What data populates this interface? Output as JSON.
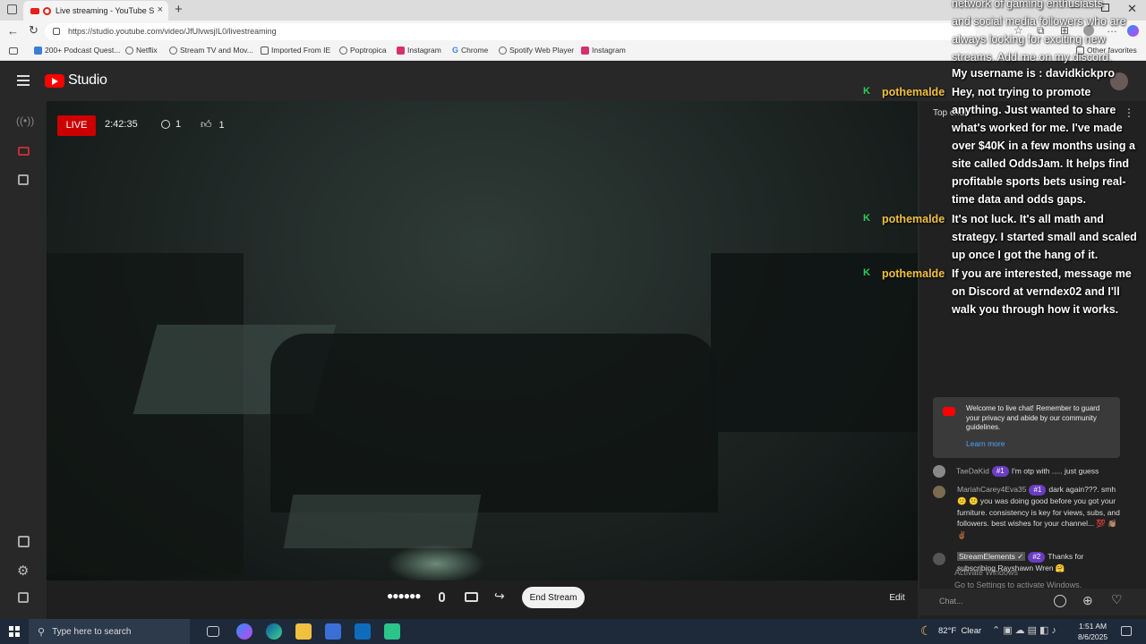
{
  "browser": {
    "tab_title": "Live streaming - YouTube St",
    "url": "https://studio.youtube.com/video/JfUlvwsjIL0/livestreaming",
    "favorites": [
      {
        "label": "200+ Podcast Quest...",
        "icon": "podcast-icon",
        "color": "#3b7dd8"
      },
      {
        "label": "Netflix",
        "icon": "globe-icon",
        "color": "#666666"
      },
      {
        "label": "Stream TV and Mov...",
        "icon": "globe-icon",
        "color": "#666666"
      },
      {
        "label": "Imported From IE",
        "icon": "folder-icon",
        "color": "#555555"
      },
      {
        "label": "Poptropica",
        "icon": "globe-icon",
        "color": "#666666"
      },
      {
        "label": "Instagram",
        "icon": "instagram-icon",
        "color": "#d6306e"
      },
      {
        "label": "Chrome",
        "icon": "google-icon",
        "color": "#4285f4"
      },
      {
        "label": "Spotify Web Player",
        "icon": "globe-icon",
        "color": "#666666"
      },
      {
        "label": "Instagram",
        "icon": "instagram-icon",
        "color": "#d6306e"
      }
    ],
    "other_favorites": "Other favorites"
  },
  "studio": {
    "brand": "Studio",
    "live_badge": "LIVE",
    "elapsed": "2:42:35",
    "viewers": "1",
    "likes": "1",
    "end_stream": "End Stream",
    "edit": "Edit",
    "top_chat": "Top chat"
  },
  "overlay": {
    "intro_lines": [
      "network of gaming enthusiasts",
      "and social media followers who are",
      "always looking for exciting new",
      "streams. Add me on my discord.",
      "My username is : davidkickpro"
    ],
    "comments": [
      {
        "user": "pothemalde",
        "lines": [
          "Hey, not trying to promote",
          "anything. Just wanted to share",
          "what's worked for me. I've made",
          "over $40K in a few months using a",
          "site called OddsJam. It helps find",
          "profitable sports bets using real-",
          "time data and odds gaps."
        ]
      },
      {
        "user": "pothemalde",
        "lines": [
          "It's not luck. It's all math and",
          "strategy. I started small and scaled",
          "up once I got the hang of it."
        ]
      },
      {
        "user": "pothemalde",
        "lines": [
          "If you are interested, message me",
          "on Discord at verndex02 and I'll",
          "walk you through how it works."
        ]
      }
    ],
    "badge_letter": "K",
    "badge_color": "#28d05a",
    "user_color": "#f0c040"
  },
  "chat": {
    "welcome": "Welcome to live chat! Remember to guard your privacy and abide by our community guidelines.",
    "learn_more": "Learn more",
    "messages": [
      {
        "name": "TaeDaKid",
        "rank": "#1",
        "text": "I'm otp with ..... just guess"
      },
      {
        "name": "MariahCarey4Eva35",
        "rank": "#1",
        "text": "dark again???. smh 😕 😕 you was doing good before you got your furniture. consistency is key for views, subs, and followers. best wishes for your channel... 💯 👏🏽 ✌🏾"
      },
      {
        "name": "StreamElements ✓",
        "rank": "#2",
        "text": "Thanks for subscribing Rayshawn Wren 🤗"
      }
    ],
    "windows_watermark": "Go to Settings to activate Windows.",
    "activate_windows": "Activate Windows",
    "input_placeholder": "Chat..."
  },
  "taskbar": {
    "search_placeholder": "Type here to search",
    "weather": "82°F  Clear",
    "time": "1:51 AM",
    "date": "8/6/2025"
  }
}
